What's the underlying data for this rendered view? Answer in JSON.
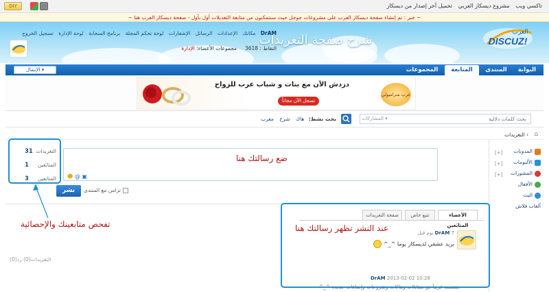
{
  "topbar": {
    "links": [
      "تاكسي ويب",
      "مشروع ديسكاز العربي",
      "تحميل آخر إصدار من ديسكاز"
    ],
    "diy_label": "DIY"
  },
  "news": {
    "text": "~ خبر : تم إنشاء صفحة ديسكاز العرب على مشروعات جوجل حيث سنتمكنون من متابعة التعديلات أول بأول - صفحة ديسكاز العرب هنا ~"
  },
  "header": {
    "page_title": "شرح صفحة التغريدات",
    "logo_arabic": "العرب",
    "logo_latin": "DISCUZ!",
    "username": "DrAM",
    "user_links": [
      "DrAM",
      "مكانك",
      "الإعدادات",
      "الرسائل",
      "الإشعارات",
      "لوحة تحكم المجلة",
      "برنامج السحابة",
      "لوحة الإدارة",
      "تسجيل الخروج"
    ],
    "points_label": "النقاط :",
    "points_value": "3618",
    "group_label": "مجموعات الأعضاء:",
    "group_value": "الإدارة"
  },
  "nav": {
    "tabs": [
      "البوابة",
      "المنتدى",
      "المتابعة",
      "المجموعات"
    ],
    "active_tab": "المتابعة",
    "quick_label": "الإنتقال"
  },
  "banner": {
    "headline": "دردش الآن مع بنات و شباب عرب للزواج",
    "cta": "تسجل الآن مجاناً",
    "brand": "عرب متراميولي"
  },
  "search": {
    "placeholder": "بحث كلمات دلالية",
    "scope": "المشاركات",
    "hot_label": "بحث نشط:",
    "hot_items": [
      "هاك",
      "شرح",
      "معرب"
    ]
  },
  "breadcrumb": {
    "current": "التغريدات"
  },
  "sidebar": {
    "items": [
      {
        "label": "المدونات",
        "color": "#e07b20"
      },
      {
        "label": "الألبومات",
        "color": "#2b8fd6"
      },
      {
        "label": "المشورات",
        "color": "#d43b3b"
      },
      {
        "label": "الأفعال",
        "color": "#4aa84a"
      },
      {
        "label": "البث",
        "color": "#2b8fd6"
      },
      {
        "label": "ألعاب فلاش",
        "color": ""
      }
    ]
  },
  "stats": {
    "items": [
      {
        "label": "التغريدات",
        "value": "31"
      },
      {
        "label": "المتابَعين",
        "value": "1"
      },
      {
        "label": "المتابعين",
        "value": "3"
      }
    ]
  },
  "compose": {
    "post_button": "نشر",
    "sync_label": "تزامن مع المنتدى",
    "count_text": "التغريدات(0) رد(0)"
  },
  "feed": {
    "tabs": [
      "الأعضاء المتابَعين",
      "تتبع خاص",
      "صفحة التغريدات"
    ],
    "active_tab": "الأعضاء المتابَعين",
    "post1_user": "DrAM",
    "post1_time": "يوم قبل",
    "post1_count": "7",
    "post1_body": "بريد عشقي لديسكاز يوما ^_^",
    "post2_user": "DrAM",
    "post2_time": "2013-02-02 10:28",
    "post2_body": "ستسعد قريباً مع ستايلات وهاكات وشروحات وإضافات جديدة ^_^"
  },
  "annotations": {
    "compose_hint": "ضع رسالتك هنا",
    "stats_hint": "تفحص متابعينك والإحصائية",
    "feed_hint": "عند النشر تظهر رسالتك هنا",
    "color": "#b01818",
    "box_color": "#1f8fd0"
  }
}
